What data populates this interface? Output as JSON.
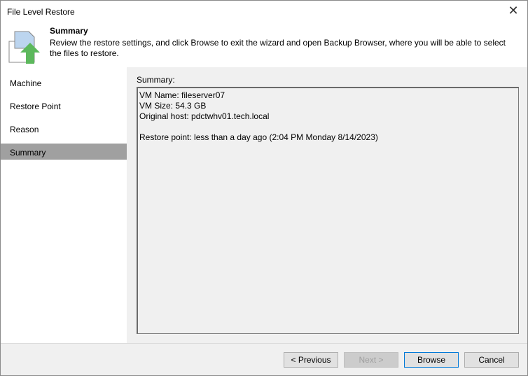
{
  "window": {
    "title": "File Level Restore",
    "close": "✕"
  },
  "header": {
    "title": "Summary",
    "description": "Review the restore settings, and click Browse to exit the wizard and open Backup Browser, where you will be able to select the files to restore."
  },
  "sidebar": {
    "items": [
      {
        "label": "Machine"
      },
      {
        "label": "Restore Point"
      },
      {
        "label": "Reason"
      },
      {
        "label": "Summary"
      }
    ]
  },
  "main": {
    "label": "Summary:",
    "lines": [
      "VM Name: fileserver07",
      "VM Size: 54.3 GB",
      "Original host: pdctwhv01.tech.local",
      "",
      "Restore point: less than a day ago (2:04 PM Monday 8/14/2023)"
    ]
  },
  "footer": {
    "previous": "< Previous",
    "next": "Next >",
    "browse": "Browse",
    "cancel": "Cancel"
  }
}
